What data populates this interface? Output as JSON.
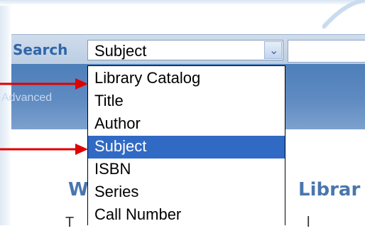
{
  "search": {
    "label": "Search",
    "selected_value": "Subject",
    "dropdown_arrow_icon": "chevron-down-icon"
  },
  "advanced_link": "Advanced",
  "dropdown_options": [
    {
      "label": "Library Catalog",
      "selected": false
    },
    {
      "label": "Title",
      "selected": false
    },
    {
      "label": "Author",
      "selected": false
    },
    {
      "label": "Subject",
      "selected": true
    },
    {
      "label": "ISBN",
      "selected": false
    },
    {
      "label": "Series",
      "selected": false
    },
    {
      "label": "Call Number",
      "selected": false
    }
  ],
  "heading": {
    "left_fragment": "W",
    "right_fragment": "Librar"
  },
  "body_fragments": {
    "left": "T",
    "right": "l"
  },
  "colors": {
    "accent": "#2f66a8",
    "selection": "#316ac5",
    "arrow": "#e00000"
  }
}
